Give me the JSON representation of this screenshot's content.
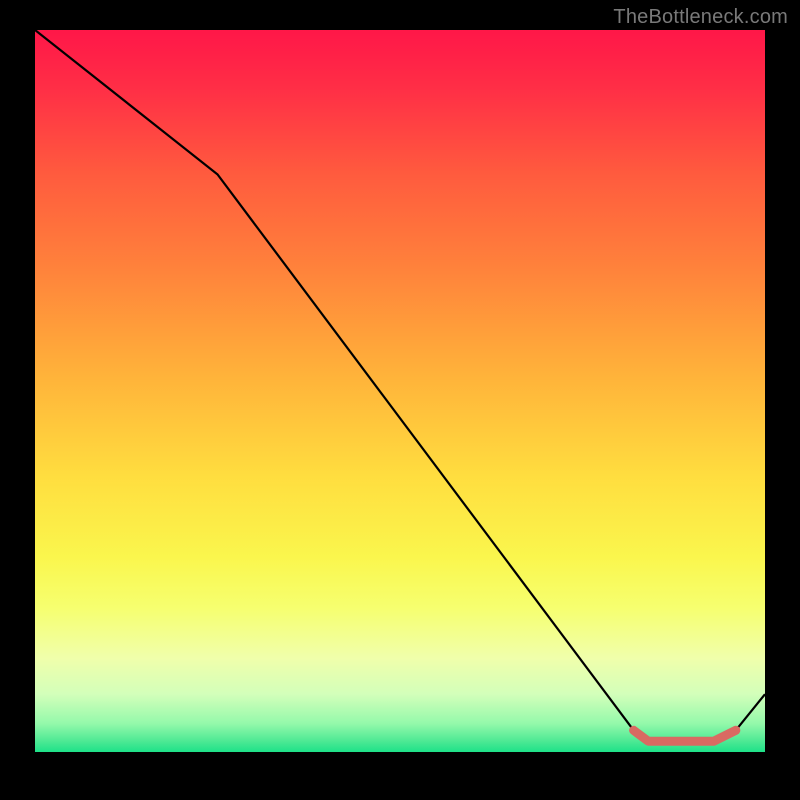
{
  "watermark": "TheBottleneck.com",
  "chart_data": {
    "type": "line",
    "title": "",
    "xlabel": "",
    "ylabel": "",
    "xlim": [
      0,
      100
    ],
    "ylim": [
      0,
      100
    ],
    "background_gradient_stops": [
      {
        "pos": 0.0,
        "color": "#ff1748"
      },
      {
        "pos": 0.2,
        "color": "#ff5b3e"
      },
      {
        "pos": 0.48,
        "color": "#ffb33a"
      },
      {
        "pos": 0.73,
        "color": "#faf64d"
      },
      {
        "pos": 0.92,
        "color": "#d3ffba"
      },
      {
        "pos": 1.0,
        "color": "#1ee189"
      }
    ],
    "series": [
      {
        "name": "bottleneck-curve",
        "stroke": "#000000",
        "x": [
          0,
          25,
          82,
          84,
          93,
          96,
          100
        ],
        "values": [
          100,
          80,
          3,
          1.5,
          1.5,
          3,
          8
        ]
      }
    ],
    "highlighted_segment": {
      "stroke": "#d96a62",
      "x_start": 82,
      "x_end": 96,
      "points_x": [
        82,
        84,
        93,
        96
      ],
      "points_values": [
        3,
        1.5,
        1.5,
        3
      ]
    }
  }
}
